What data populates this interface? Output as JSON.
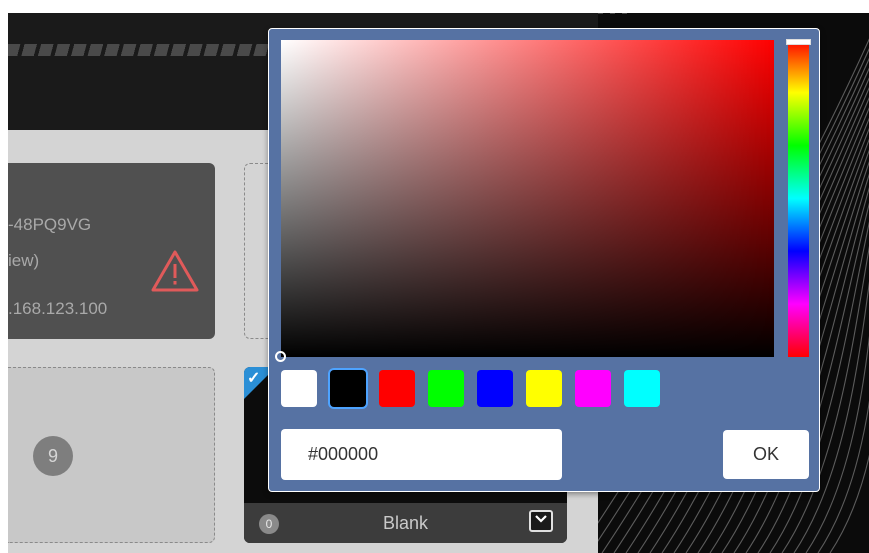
{
  "device_tile": {
    "serial_partial": "-48PQ9VG",
    "status_partial": "iew)",
    "ip_partial": ".168.123.100",
    "warning_color": "#e05a5a"
  },
  "empty_tile": {
    "number": "9"
  },
  "blank_tile": {
    "count": "0",
    "label": "Blank",
    "selected": true,
    "accent": "#2b8fd6"
  },
  "color_picker": {
    "hue_color": "#ff0000",
    "selected_color": "#000000",
    "swatches": [
      {
        "color": "#ffffff",
        "name": "white"
      },
      {
        "color": "#000000",
        "name": "black"
      },
      {
        "color": "#ff0000",
        "name": "red"
      },
      {
        "color": "#00ff00",
        "name": "green"
      },
      {
        "color": "#0000ff",
        "name": "blue"
      },
      {
        "color": "#ffff00",
        "name": "yellow"
      },
      {
        "color": "#ff00ff",
        "name": "magenta"
      },
      {
        "color": "#00ffff",
        "name": "cyan"
      }
    ],
    "hex_value": "#000000",
    "ok_label": "OK",
    "panel_color": "#5672a3"
  }
}
